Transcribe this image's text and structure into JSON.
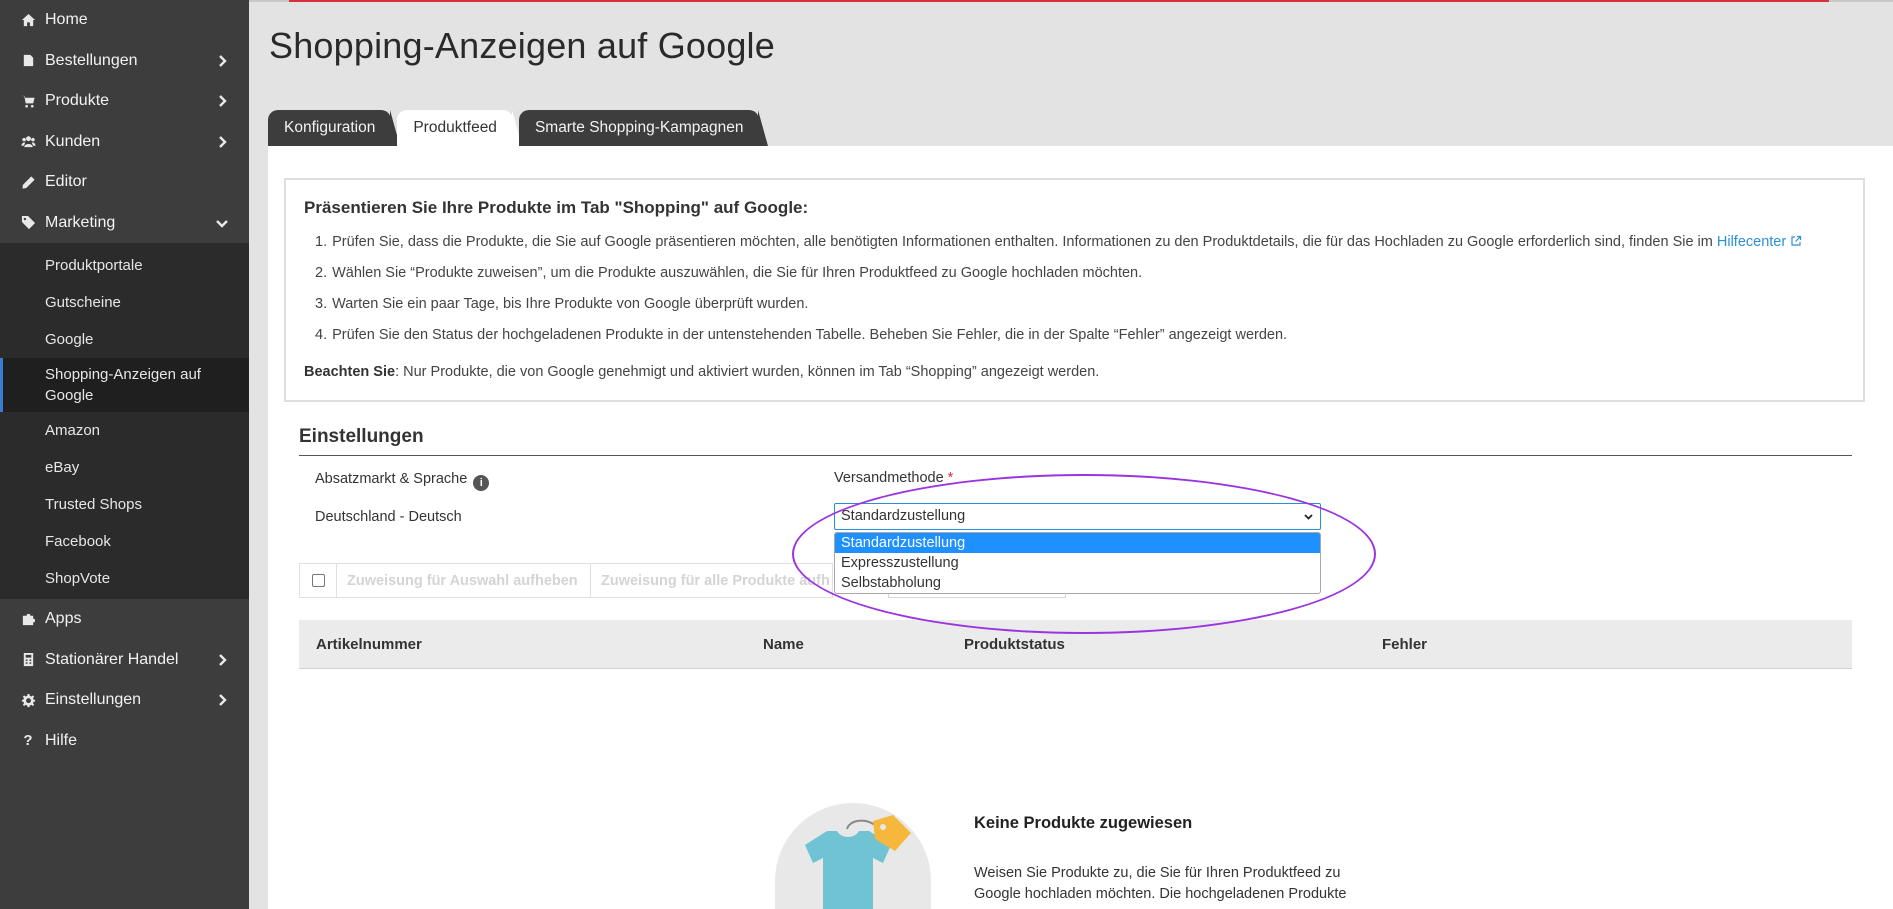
{
  "sidebar": {
    "items": [
      {
        "label": "Home",
        "icon": "home-icon"
      },
      {
        "label": "Bestellungen",
        "icon": "orders-icon"
      },
      {
        "label": "Produkte",
        "icon": "cart-icon"
      },
      {
        "label": "Kunden",
        "icon": "users-icon"
      },
      {
        "label": "Editor",
        "icon": "pencil-icon"
      },
      {
        "label": "Marketing",
        "icon": "tag-icon"
      },
      {
        "label": "Apps",
        "icon": "puzzle-icon"
      },
      {
        "label": "Stationärer Handel",
        "icon": "register-icon"
      },
      {
        "label": "Einstellungen",
        "icon": "gear-icon"
      },
      {
        "label": "Hilfe",
        "icon": "question-icon"
      }
    ],
    "marketing_sub": [
      "Produktportale",
      "Gutscheine",
      "Google",
      "Shopping-Anzeigen auf Google",
      "Amazon",
      "eBay",
      "Trusted Shops",
      "Facebook",
      "ShopVote"
    ]
  },
  "page": {
    "title": "Shopping-Anzeigen auf Google"
  },
  "tabs": [
    "Konfiguration",
    "Produktfeed",
    "Smarte Shopping-Kampagnen"
  ],
  "info": {
    "title": "Präsentieren Sie Ihre Produkte im Tab \"Shopping\" auf Google:",
    "steps": [
      "Prüfen Sie, dass die Produkte, die Sie auf Google präsentieren möchten, alle benötigten Informationen enthalten. Informationen zu den Produktdetails, die für das Hochladen zu Google erforderlich sind, finden Sie im",
      "Wählen Sie “Produkte zuweisen”, um die Produkte auszuwählen, die Sie für Ihren Produktfeed zu Google hochladen möchten.",
      "Warten Sie ein paar Tage, bis Ihre Produkte von Google überprüft wurden.",
      "Prüfen Sie den Status der hochgeladenen Produkte in der untenstehenden Tabelle. Beheben Sie Fehler, die in der Spalte “Fehler” angezeigt werden."
    ],
    "step_numbers": [
      "1.",
      "2.",
      "3.",
      "4."
    ],
    "help_link": "Hilfecenter",
    "note_label": "Beachten Sie",
    "note_text": ": Nur Produkte, die von Google genehmigt und aktiviert wurden, können im Tab “Shopping” angezeigt werden."
  },
  "settings": {
    "title": "Einstellungen",
    "market_label": "Absatzmarkt & Sprache",
    "market_value": "Deutschland - Deutsch",
    "shipping_label": "Versandmethode",
    "required_mark": "*",
    "shipping_selected": "Standardzustellung",
    "shipping_options": [
      "Standardzustellung",
      "Expresszustellung",
      "Selbstabholung"
    ]
  },
  "actions": {
    "unassign_selected": "Zuweisung für Auswahl aufheben",
    "unassign_all": "Zuweisung für alle Produkte aufh"
  },
  "table": {
    "headers": [
      "Artikelnummer",
      "Name",
      "Produktstatus",
      "Fehler"
    ]
  },
  "empty": {
    "title": "Keine Produkte zugewiesen",
    "text": "Weisen Sie Produkte zu, die Sie für Ihren Produktfeed zu Google hochladen möchten. Die hochgeladenen Produkte"
  },
  "colors": {
    "sidebar_bg": "#3d3d3d",
    "accent_red": "#d8313b",
    "link_blue": "#2b8fd6",
    "highlight_purple": "#9b34e0",
    "selected_option": "#1e90ff"
  }
}
